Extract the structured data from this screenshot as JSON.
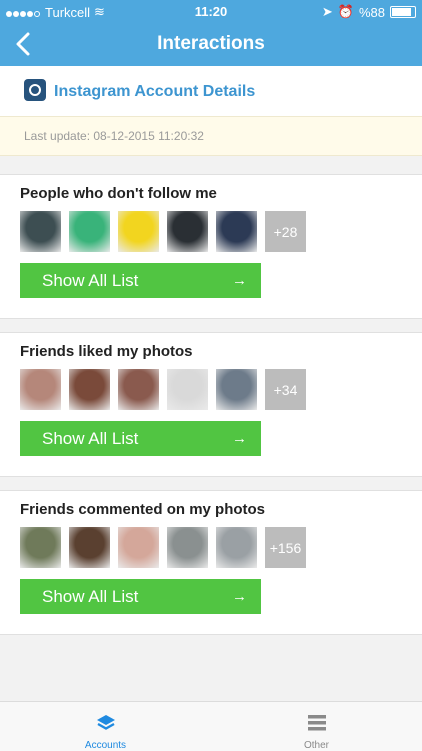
{
  "status": {
    "carrier": "Turkcell",
    "time": "11:20",
    "battery": "%88"
  },
  "nav": {
    "title": "Interactions"
  },
  "account": {
    "title": "Instagram Account Details"
  },
  "last_update": "Last update: 08-12-2015 11:20:32",
  "sections": [
    {
      "title": "People who don't follow me",
      "more": "+28",
      "button": "Show All List",
      "thumb_colors": [
        "#3d4e52",
        "#39b37a",
        "#f2d51f",
        "#2a2f34",
        "#2c3a55"
      ]
    },
    {
      "title": "Friends liked my photos",
      "more": "+34",
      "button": "Show All List",
      "thumb_colors": [
        "#b5877a",
        "#7a4a3a",
        "#8a5a4e",
        "#d9d9d9",
        "#6d7b8a"
      ]
    },
    {
      "title": "Friends commented on my photos",
      "more": "+156",
      "button": "Show All List",
      "thumb_colors": [
        "#6f7a5a",
        "#5a4030",
        "#d4a79a",
        "#8a9090",
        "#9aa0a4"
      ]
    }
  ],
  "tabs": [
    {
      "label": "Accounts",
      "color": "#1f8ae0"
    },
    {
      "label": "Other",
      "color": "#8a8a8a"
    }
  ]
}
